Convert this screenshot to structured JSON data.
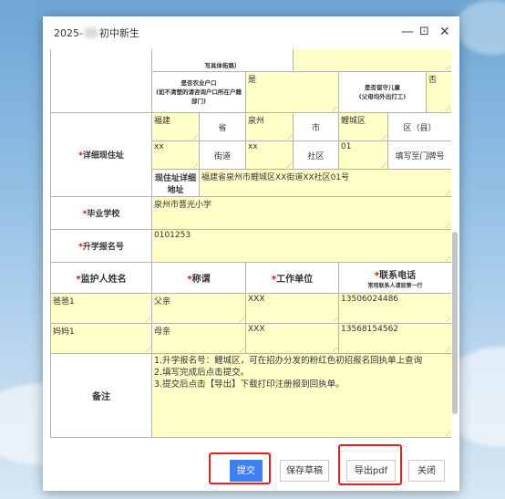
{
  "dialog": {
    "title_prefix": "2025",
    "title_suffix": "初中新生",
    "buttons": {
      "minimize": "—",
      "maximize": "⊡",
      "close": "✕"
    }
  },
  "form": {
    "top_cut_label": "写具体街路）",
    "agri_label_1": "是否农业户口",
    "agri_label_2": "(如不清楚的请咨询户口所在户籍部门)",
    "agri_value": "是",
    "leftbehind_label_1": "是否留守儿童",
    "leftbehind_label_2": "(父母均外出打工)",
    "leftbehind_value": "否",
    "address_label": "*详细现住址",
    "province": "福建",
    "province_unit": "省",
    "city": "泉州",
    "city_unit": "市",
    "district": "鲤城区",
    "district_unit": "区（县）",
    "street": "xx",
    "street_unit": "街道",
    "community": "xx",
    "community_unit": "社区",
    "doorplate": "01",
    "doorplate_unit": "填写至门牌号",
    "full_address_label": "现住址详细地址",
    "full_address": "福建省泉州市鲤城区XX街道XX社区01号",
    "school_label": "*毕业学校",
    "school": "泉州市晋光小学",
    "reg_no_label": "*升学报名号",
    "reg_no": "0101253",
    "guardian_name_header": "*监护人姓名",
    "relation_header": "*称谓",
    "work_header": "*工作单位",
    "phone_header": "*联系电话",
    "phone_sub": "常用联系人请放第一行",
    "guardians": [
      {
        "name": "爸爸1",
        "relation": "父亲",
        "work": "XXX",
        "phone": "13506024486"
      },
      {
        "name": "妈妈1",
        "relation": "母亲",
        "work": "XXX",
        "phone": "13568154562"
      }
    ],
    "remarks_label": "备注",
    "remarks_1": "1.升学报名号：鲤城区，可在招办分发的粉红色初招报名回执单上查询",
    "remarks_2": "2.填写完成后点击提交。",
    "remarks_3": "3.提交后点击【导出】下载打印注册报到回执单。"
  },
  "footer": {
    "submit": "提交",
    "save_draft": "保存草稿",
    "export_pdf": "导出pdf",
    "close": "关闭"
  }
}
